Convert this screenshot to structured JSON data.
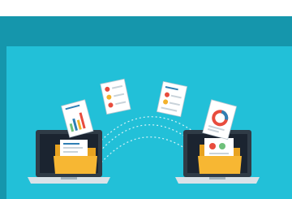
{
  "illustration": {
    "subject": "file-transfer-between-laptops",
    "colors": {
      "background_dark": "#1596ac",
      "background_light": "#22c0d8",
      "folder": "#f7b733",
      "folder_back": "#e8a320",
      "laptop_body": "#2f3b46",
      "screen": "#1b2430",
      "document": "#ffffff",
      "accent_red": "#e84c3d",
      "accent_blue": "#2f7fb4",
      "accent_yellow": "#f3b12a",
      "accent_green": "#6ec07a"
    }
  }
}
